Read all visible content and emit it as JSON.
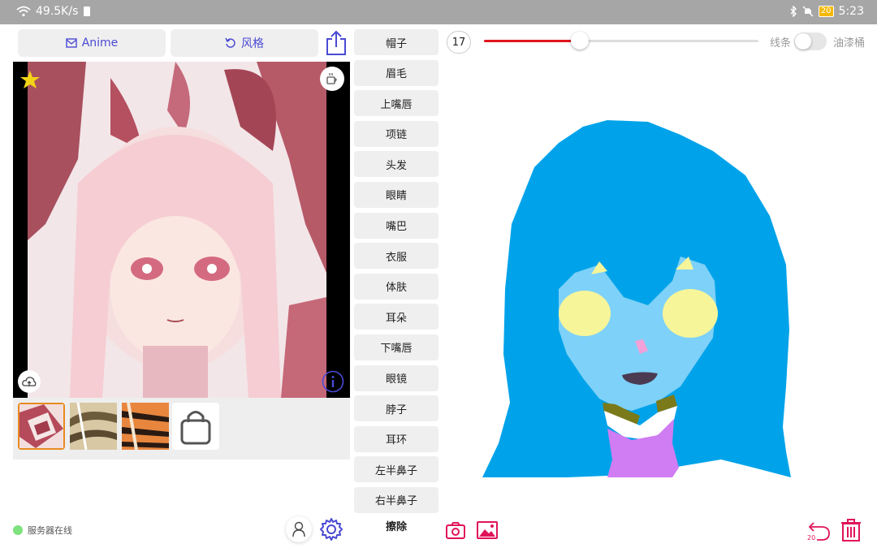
{
  "status_bar": {
    "net_speed": "49.5K/s",
    "battery": "20",
    "time": "5:23"
  },
  "toolbar": {
    "anime_label": "Anime",
    "style_label": "风格"
  },
  "parts": [
    {
      "label": "帽子"
    },
    {
      "label": "眉毛"
    },
    {
      "label": "上嘴唇"
    },
    {
      "label": "项链"
    },
    {
      "label": "头发"
    },
    {
      "label": "眼睛"
    },
    {
      "label": "嘴巴"
    },
    {
      "label": "衣服"
    },
    {
      "label": "体肤"
    },
    {
      "label": "耳朵"
    },
    {
      "label": "下嘴唇"
    },
    {
      "label": "眼镜"
    },
    {
      "label": "脖子"
    },
    {
      "label": "耳环"
    },
    {
      "label": "左半鼻子"
    },
    {
      "label": "右半鼻子"
    }
  ],
  "erase_label": "擦除",
  "brush": {
    "size": "17",
    "slider_fraction": 0.35,
    "mode_line_label": "线条",
    "mode_fill_label": "油漆桶",
    "fill_mode_on": false
  },
  "server_status": "服务器在线",
  "undo_count": "20",
  "colors": {
    "accent": "#e0145a",
    "purple": "#4a4ad4",
    "hair": "#00a3ea",
    "skin": "#7ed1f8",
    "eyes": "#f6f59a",
    "clothes": "#d07cf2",
    "neck": "#7a7a1a",
    "mouth": "#4a3b53",
    "nose": "#f2a2d8",
    "online": "#7ee27e"
  }
}
